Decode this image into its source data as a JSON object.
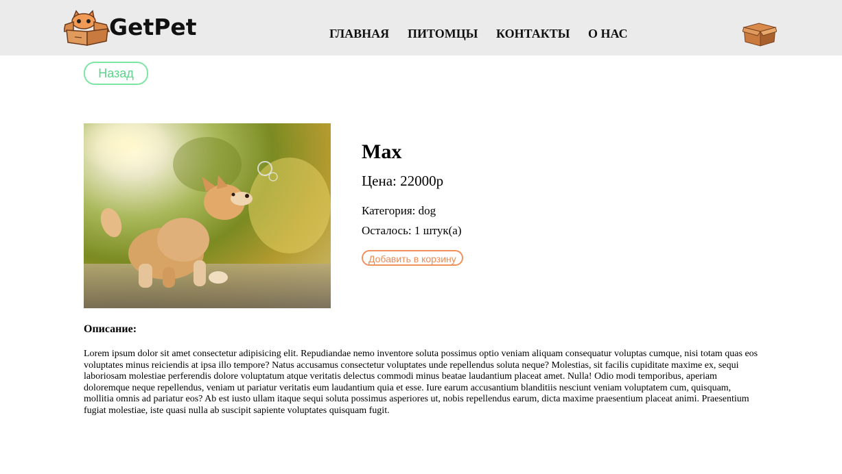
{
  "header": {
    "logo_text": "GetPet",
    "nav": [
      {
        "label": "ГЛАВНАЯ"
      },
      {
        "label": "ПИТОМЦЫ"
      },
      {
        "label": "КОНТАКТЫ"
      },
      {
        "label": "О НАС"
      }
    ],
    "cart_icon": "cardboard-box-icon"
  },
  "back_button": {
    "label": "Назад"
  },
  "pet": {
    "name": "Max",
    "price": "Цена: 22000р",
    "category": "Категория: dog",
    "stock": "Осталось: 1 штук(а)",
    "add_to_cart_label": "Добавить в корзину",
    "photo_icon": "dog-photo"
  },
  "description": {
    "title": "Описание:",
    "text": "Lorem ipsum dolor sit amet consectetur adipisicing elit. Repudiandae nemo inventore soluta possimus optio veniam aliquam consequatur voluptas cumque, nisi totam quas eos voluptates minus reiciendis at ipsa illo tempore? Natus accusamus consectetur voluptates unde repellendus soluta neque? Molestias, sit facilis cupiditate maxime ex, sequi laboriosam molestiae perferendis dolore voluptatum atque veritatis delectus commodi minus beatae laudantium placeat amet. Nulla! Odio modi temporibus, aperiam doloremque neque repellendus, veniam ut pariatur veritatis eum laudantium quia et esse. Iure earum accusantium blanditiis nesciunt veniam voluptatem cum, quisquam, mollitia omnis ad pariatur eos? Ab est iusto ullam itaque sequi soluta possimus asperiores ut, nobis repellendus earum, dicta maxime praesentium placeat animi. Praesentium fugiat molestiae, iste quasi nulla ab suscipit sapiente voluptates quisquam fugit."
  },
  "colors": {
    "header_bg": "#ebebeb",
    "back_button_border": "#7ee6a3",
    "add_button_border": "#f0905a"
  }
}
